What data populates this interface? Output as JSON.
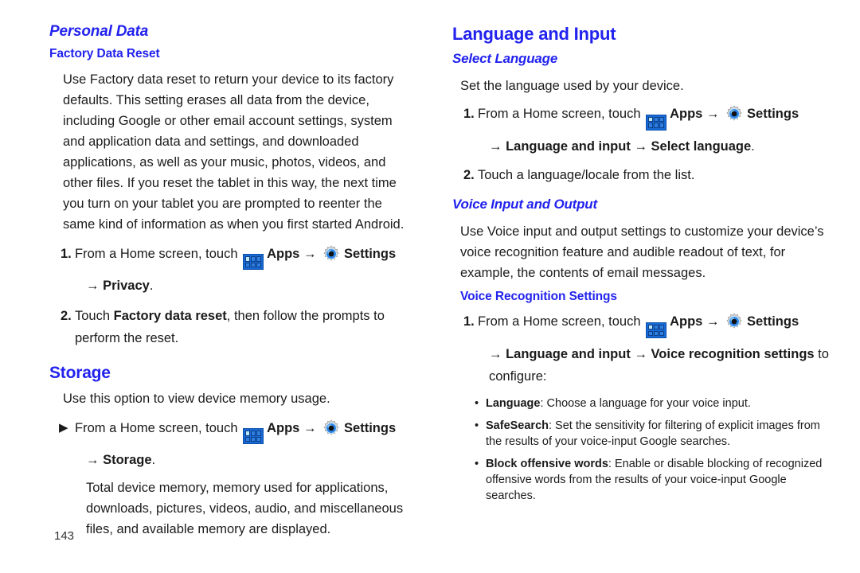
{
  "document": {
    "page_number": "143",
    "accent_color": "#2222ee",
    "text_color": "#1c1c1c"
  },
  "icons": {
    "apps": "apps-grid-icon",
    "settings": "settings-gear-icon",
    "arrow": "→",
    "triangle_marker": "▶",
    "bullet_dot": "•"
  },
  "left_column": {
    "section_heading": "Personal Data",
    "sub_heading": "Factory Data Reset",
    "intro_paragraph": "Use Factory data reset to return your device to its factory defaults. This setting erases all data from the device, including Google or other email account settings, system and application data and settings, and downloaded applications, as well as your music, photos, videos, and other files. If you reset the tablet in this way, the next time you turn on your tablet you are prompted to reenter the same kind of information as when you first started Android.",
    "steps": [
      {
        "number": "1.",
        "lead": "From a Home screen, touch",
        "apps_label": "Apps",
        "settings_label": "Settings",
        "continuation_prefix": "",
        "continuation_bold": "Privacy",
        "continuation_suffix": "."
      },
      {
        "number": "2.",
        "prefix": "Touch ",
        "bold": "Factory data reset",
        "suffix": ", then follow the prompts to perform the reset."
      }
    ],
    "storage": {
      "heading": "Storage",
      "intro": "Use this option to view device memory usage.",
      "step": {
        "marker": "▶",
        "lead": "From a Home screen, touch",
        "apps_label": "Apps",
        "settings_label": "Settings",
        "continuation_bold": "Storage",
        "continuation_suffix": "."
      },
      "detail": "Total device memory, memory used for applications, downloads, pictures, videos, audio, and miscellaneous files, and available memory are displayed."
    }
  },
  "right_column": {
    "section_heading": "Language and Input",
    "select_language": {
      "heading": "Select Language",
      "intro": "Set the language used by your device.",
      "step1": {
        "number": "1.",
        "lead": "From a Home screen, touch",
        "apps_label": "Apps",
        "settings_label": "Settings",
        "continuation_bold_1": "Language and input",
        "continuation_bold_2": "Select language",
        "continuation_suffix": "."
      },
      "step2": {
        "number": "2.",
        "text": "Touch a language/locale from the list."
      }
    },
    "voice_input": {
      "heading": "Voice Input and Output",
      "intro": "Use Voice input and output settings to customize your device’s voice recognition feature and audible readout of text, for example, the contents of email messages.",
      "sub_heading": "Voice Recognition Settings",
      "step1": {
        "number": "1.",
        "lead": "From a Home screen, touch",
        "apps_label": "Apps",
        "settings_label": "Settings",
        "continuation_bold_1": "Language and input",
        "continuation_bold_2": "Voice recognition settings",
        "continuation_suffix": " to",
        "continuation_line2": "configure:"
      },
      "bullets": [
        {
          "term": "Language",
          "description": ": Choose a language for your voice input."
        },
        {
          "term": "SafeSearch",
          "description": ": Set the sensitivity for filtering of explicit images from the results of your voice-input Google searches."
        },
        {
          "term": "Block offensive words",
          "description": ": Enable or disable blocking of recognized offensive words from the results of your voice-input Google searches."
        }
      ]
    }
  }
}
